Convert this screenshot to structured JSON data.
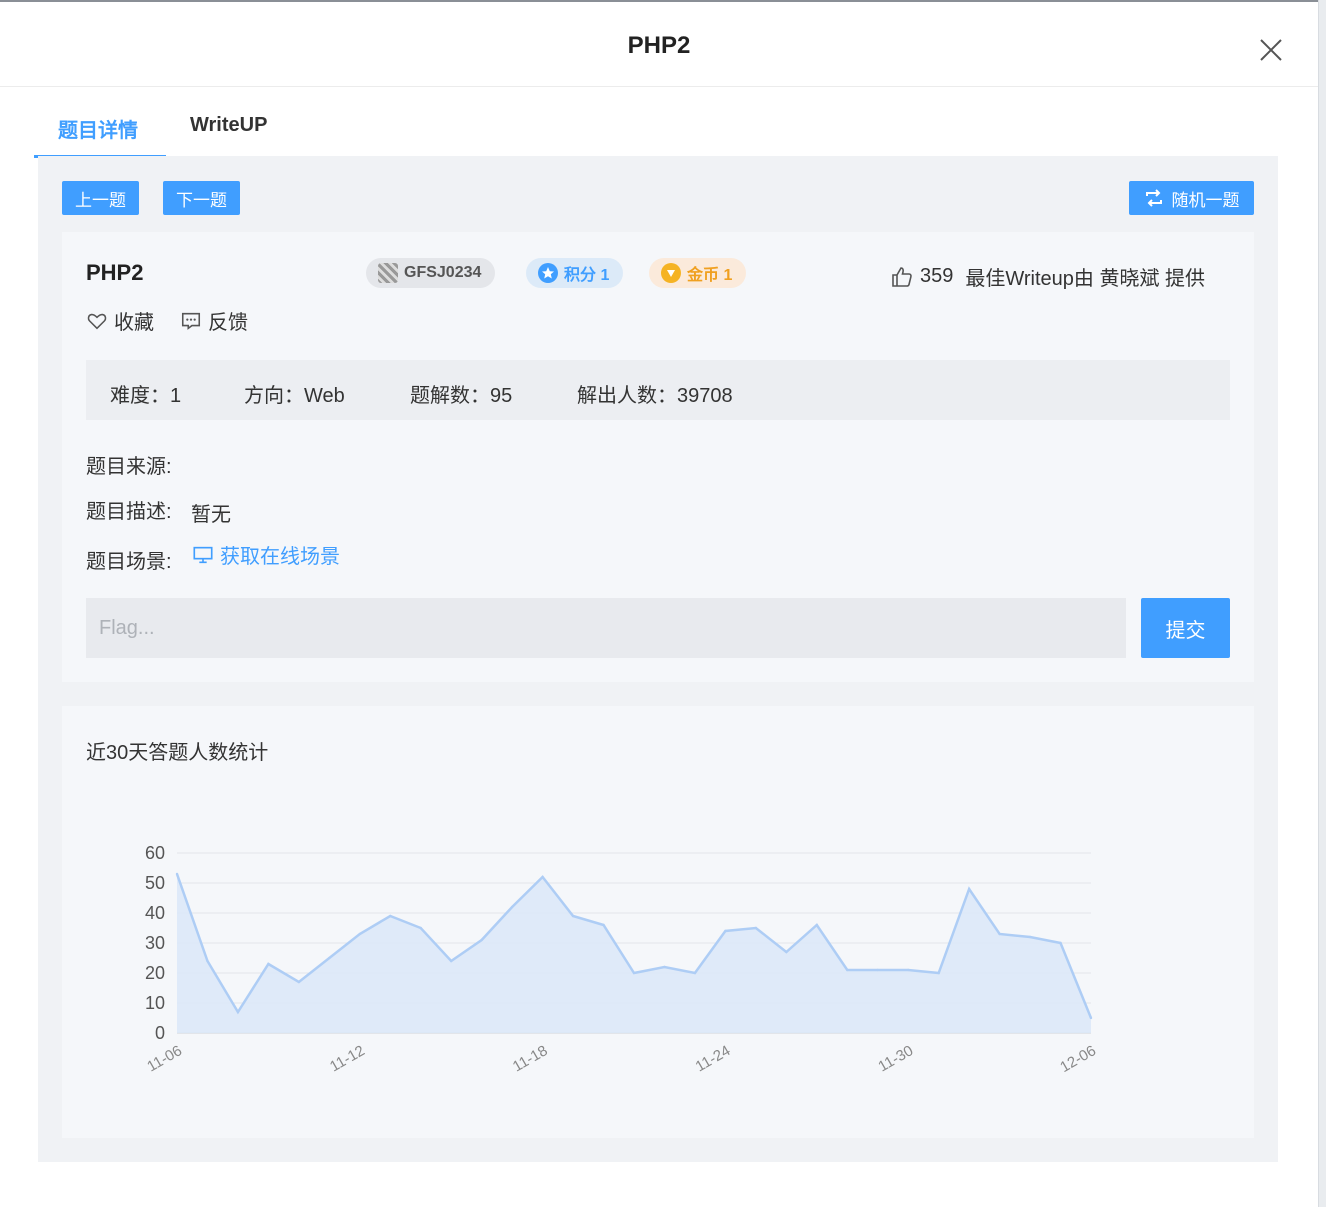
{
  "dialog": {
    "title": "PHP2"
  },
  "tabs": [
    {
      "label": "题目详情",
      "active": true
    },
    {
      "label": "WriteUP",
      "active": false
    }
  ],
  "nav": {
    "prev": "上一题",
    "next": "下一题",
    "random": "随机一题"
  },
  "question": {
    "title": "PHP2",
    "id_tag": "GFSJ0234",
    "points_tag": "积分 1",
    "coins_tag": "金币 1",
    "likes": "359",
    "writeup_by": "最佳Writeup由 黄晓斌 提供",
    "favorite": "收藏",
    "feedback": "反馈"
  },
  "stats": {
    "difficulty": "难度：1",
    "direction": "方向：Web",
    "solutions": "题解数：95",
    "solvers": "解出人数：39708"
  },
  "fields": {
    "source_label": "题目来源:",
    "desc_label": "题目描述:",
    "desc_value": "暂无",
    "scene_label": "题目场景:",
    "scene_link": "获取在线场景"
  },
  "flag": {
    "placeholder": "Flag...",
    "value": "",
    "submit": "提交"
  },
  "colors": {
    "accent": "#409eff",
    "coin": "#f0a020",
    "panel": "#f5f7fa"
  },
  "chart_data": {
    "type": "area",
    "title": "近30天答题人数统计",
    "x": [
      "11-06",
      "11-07",
      "11-08",
      "11-09",
      "11-10",
      "11-11",
      "11-12",
      "11-13",
      "11-14",
      "11-15",
      "11-16",
      "11-17",
      "11-18",
      "11-19",
      "11-20",
      "11-21",
      "11-22",
      "11-23",
      "11-24",
      "11-25",
      "11-26",
      "11-27",
      "11-28",
      "11-29",
      "11-30",
      "12-01",
      "12-02",
      "12-03",
      "12-04",
      "12-05",
      "12-06"
    ],
    "x_tick_labels": [
      "11-06",
      "11-12",
      "11-18",
      "11-24",
      "11-30",
      "12-06"
    ],
    "values": [
      53,
      24,
      7,
      23,
      17,
      25,
      33,
      39,
      35,
      24,
      31,
      42,
      52,
      39,
      36,
      20,
      22,
      20,
      34,
      35,
      27,
      36,
      21,
      21,
      21,
      20,
      48,
      33,
      32,
      30,
      5
    ],
    "ylim": [
      0,
      60
    ],
    "yticks": [
      0,
      10,
      20,
      30,
      40,
      50,
      60
    ],
    "grid": true,
    "legend": "none",
    "color": "#aecdf5"
  }
}
